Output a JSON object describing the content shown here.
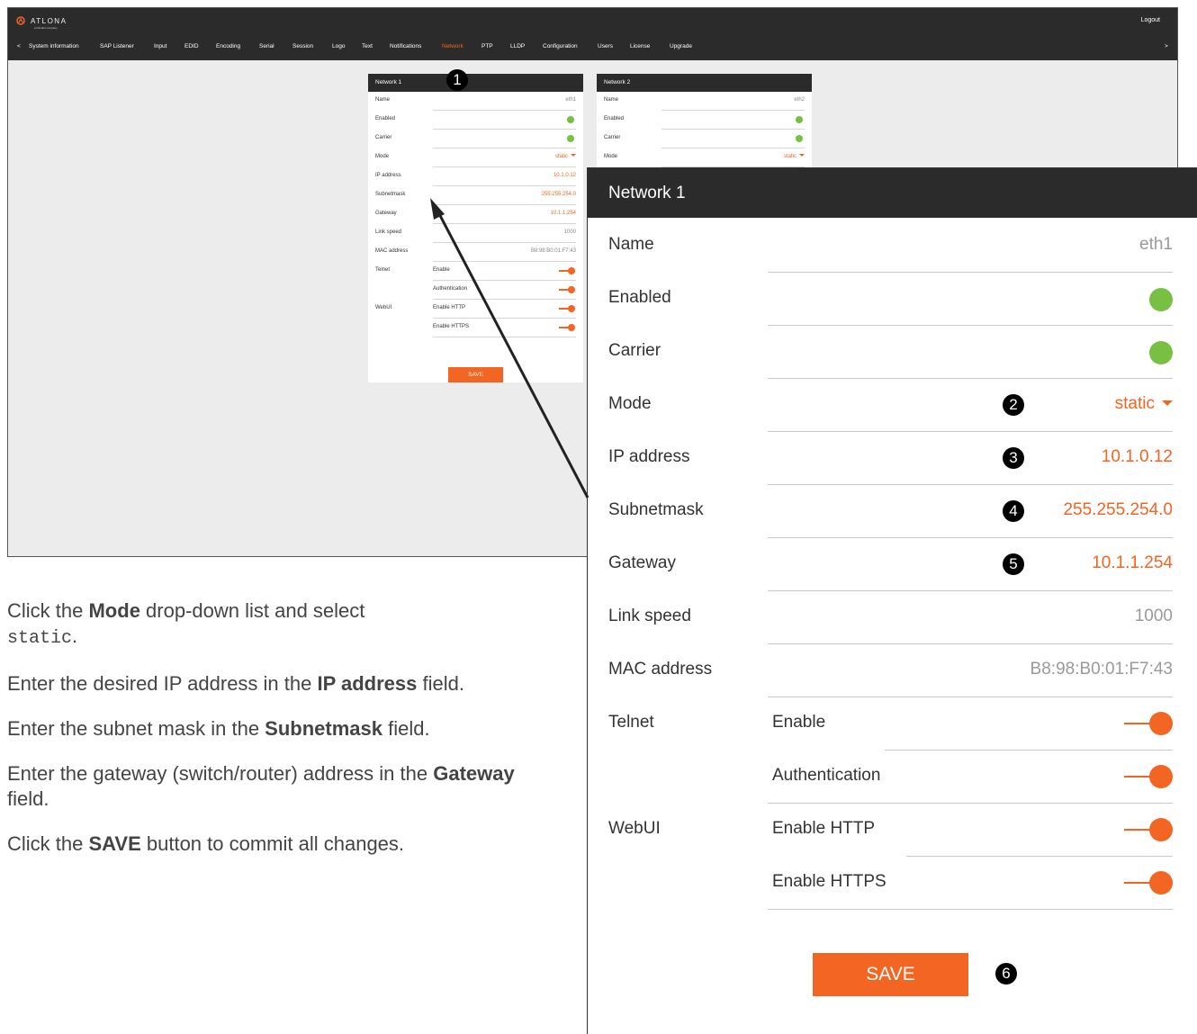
{
  "app": {
    "brand": "ATLONA",
    "brand_sub": "a Panduit company",
    "logout_label": "Logout",
    "nav": {
      "prev": "<",
      "next": ">",
      "items": [
        "System information",
        "SAP Listener",
        "Input",
        "EDID",
        "Encoding",
        "Serial",
        "Session",
        "Logo",
        "Text",
        "Notifications",
        "Network",
        "PTP",
        "LLDP",
        "Configuration",
        "Users",
        "License",
        "Upgrade"
      ],
      "active": "Network"
    }
  },
  "network1": {
    "title": "Network 1",
    "name_label": "Name",
    "name_value": "eth1",
    "enabled_label": "Enabled",
    "carrier_label": "Carrier",
    "mode_label": "Mode",
    "mode_value": "static",
    "ip_label": "IP address",
    "ip_value": "10.1.0.12",
    "subnet_label": "Subnetmask",
    "subnet_value": "255.255.254.0",
    "gateway_label": "Gateway",
    "gateway_value": "10.1.1.254",
    "linkspeed_label": "Link speed",
    "linkspeed_value": "1000",
    "mac_label": "MAC address",
    "mac_value": "B8:98:B0:01:F7:43",
    "telnet_label": "Telnet",
    "telnet_enable_label": "Enable",
    "telnet_auth_label": "Authentication",
    "webui_label": "WebUI",
    "webui_http_label": "Enable HTTP",
    "webui_https_label": "Enable HTTPS",
    "save_label": "SAVE"
  },
  "network2": {
    "title": "Network 2",
    "name_label": "Name",
    "name_value": "eth2",
    "enabled_label": "Enabled",
    "carrier_label": "Carrier",
    "mode_label": "Mode",
    "mode_value": "static"
  },
  "callouts": [
    "1",
    "2",
    "3",
    "4",
    "5",
    "6"
  ],
  "instructions": {
    "step1_a": "Click the ",
    "step1_bold": "Mode",
    "step1_b": " drop-down list and select",
    "step1_code": "static",
    "step1_c": ".",
    "step2_a": "Enter the desired IP address in the ",
    "step2_bold": "IP address",
    "step2_b": " field.",
    "step3_a": "Enter the subnet mask in the ",
    "step3_bold": "Subnetmask",
    "step3_b": " field.",
    "step4_a": "Enter the gateway (switch/router) address in the ",
    "step4_bold": "Gateway",
    "step4_b": " field.",
    "step5_a": "Click the ",
    "step5_bold": "SAVE",
    "step5_b": " button to commit all changes."
  },
  "colors": {
    "accent": "#f26522",
    "status_green": "#77c043",
    "header_dark": "#2b2b2b"
  },
  "icons": {
    "logo": "atlona-logo-icon",
    "dropdown": "caret-down-icon",
    "status": "status-dot-icon",
    "toggle": "toggle-on-icon"
  }
}
